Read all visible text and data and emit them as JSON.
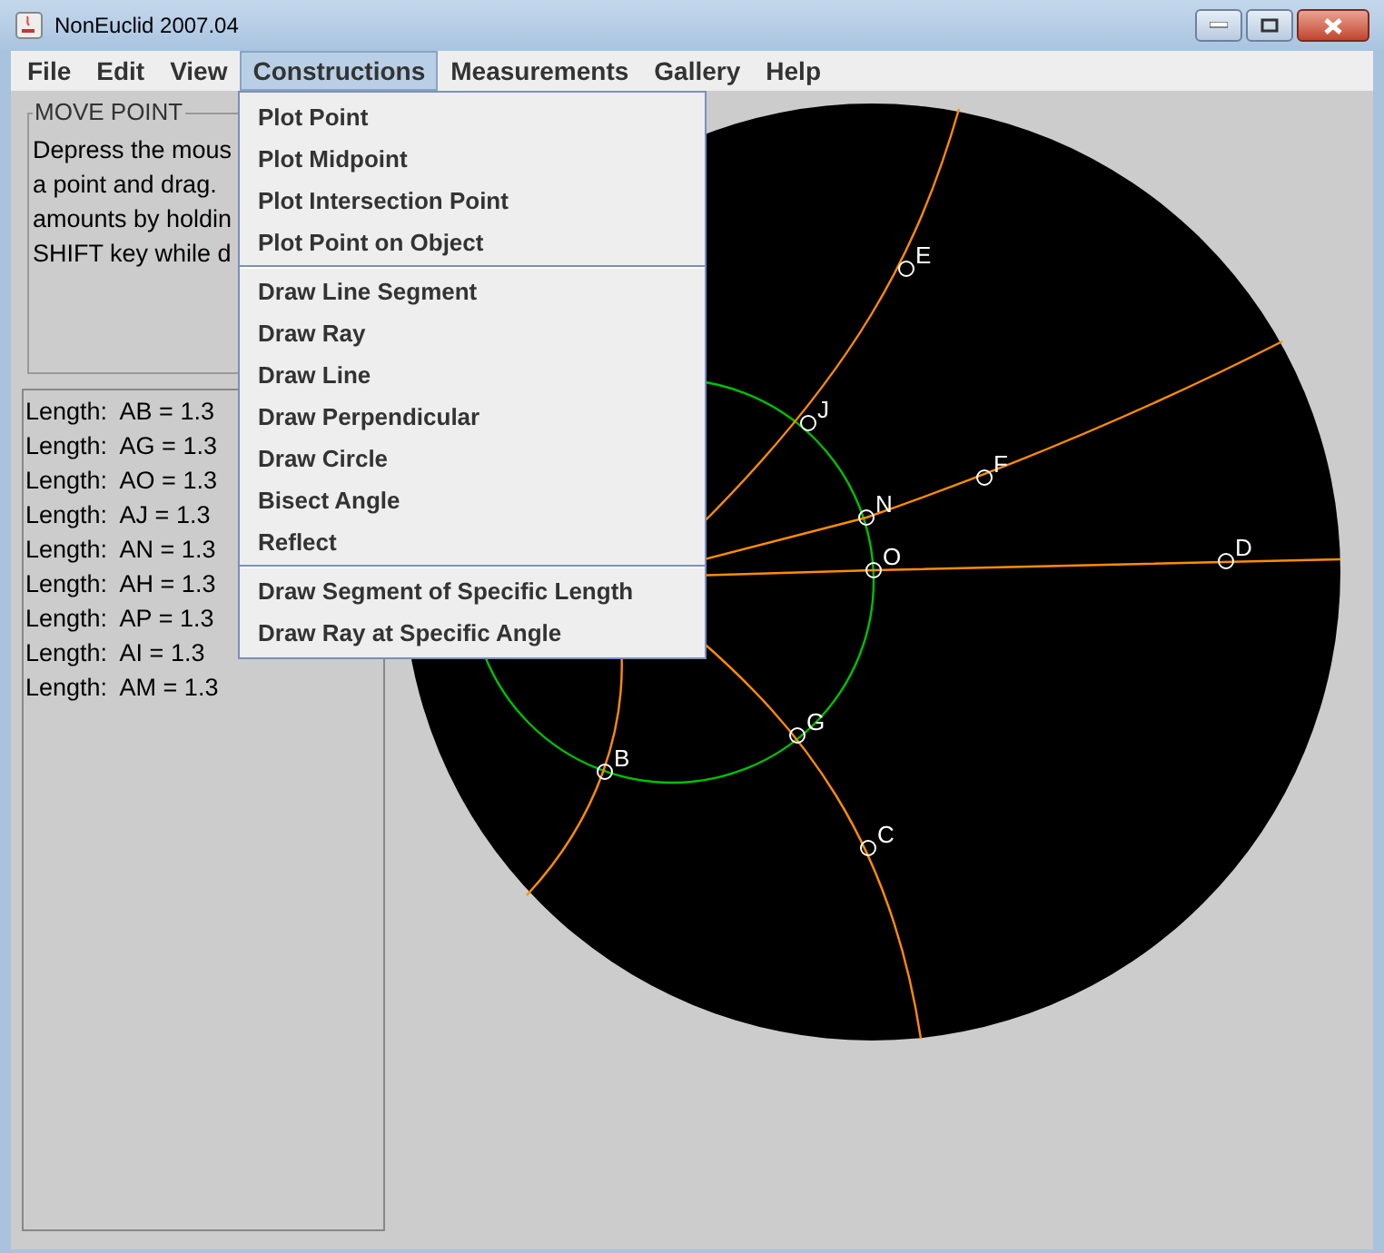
{
  "window": {
    "title": "NonEuclid 2007.04"
  },
  "menu_bar": [
    {
      "label": "File",
      "selected": false
    },
    {
      "label": "Edit",
      "selected": false
    },
    {
      "label": "View",
      "selected": false
    },
    {
      "label": "Constructions",
      "selected": true
    },
    {
      "label": "Measurements",
      "selected": false
    },
    {
      "label": "Gallery",
      "selected": false
    },
    {
      "label": "Help",
      "selected": false
    }
  ],
  "open_menu": {
    "groups": [
      [
        "Plot Point",
        "Plot Midpoint",
        "Plot Intersection Point",
        "Plot Point on Object"
      ],
      [
        "Draw Line Segment",
        "Draw Ray",
        "Draw Line",
        "Draw Perpendicular",
        "Draw Circle",
        "Bisect Angle",
        "Reflect"
      ],
      [
        "Draw Segment of Specific Length",
        "Draw Ray at Specific Angle"
      ]
    ]
  },
  "tool_panel": {
    "title": "MOVE POINT",
    "lines": [
      "Depress the mous",
      "a point and drag.",
      "amounts by holdin",
      "SHIFT key while d"
    ]
  },
  "measurements": [
    "Length:  AB = 1.3",
    "Length:  AG = 1.3",
    "Length:  AO = 1.3",
    "Length:  AJ = 1.3",
    "Length:  AN = 1.3",
    "Length:  AH = 1.3",
    "Length:  AP = 1.3",
    "Length:  AI = 1.3",
    "Length:  AM = 1.3"
  ],
  "canvas": {
    "points": [
      "E",
      "J",
      "F",
      "N",
      "O",
      "D",
      "G",
      "B",
      "C"
    ]
  }
}
